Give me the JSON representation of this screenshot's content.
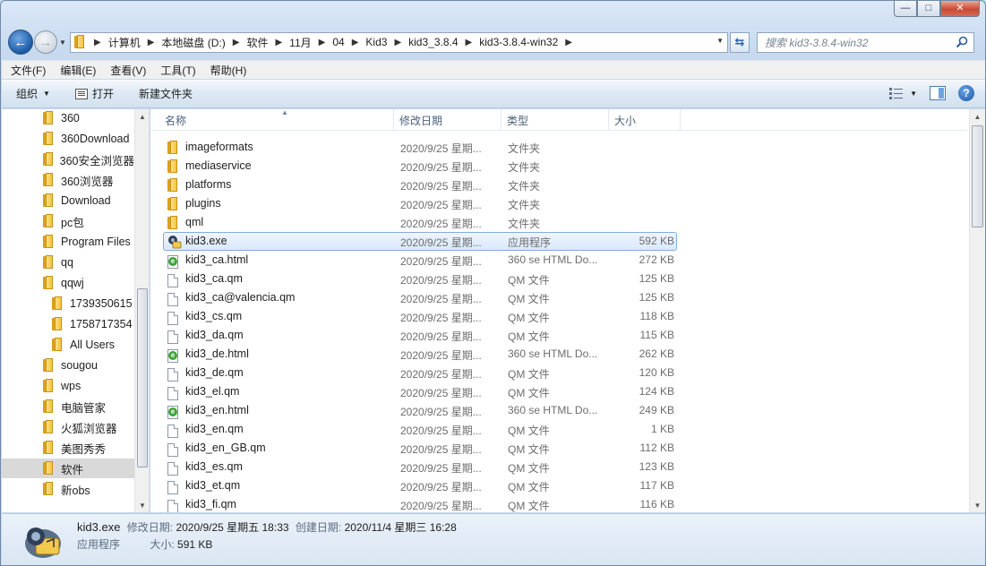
{
  "window": {
    "caption_buttons": {
      "minimize": "—",
      "maximize": "□",
      "close": "✕"
    }
  },
  "address_bar": {
    "breadcrumbs": [
      "计算机",
      "本地磁盘 (D:)",
      "软件",
      "11月",
      "04",
      "Kid3",
      "kid3_3.8.4",
      "kid3-3.8.4-win32"
    ]
  },
  "search": {
    "placeholder": "搜索 kid3-3.8.4-win32"
  },
  "menubar": {
    "items": [
      "文件(F)",
      "编辑(E)",
      "查看(V)",
      "工具(T)",
      "帮助(H)"
    ]
  },
  "commandbar": {
    "organize": "组织",
    "open": "打开",
    "new_folder": "新建文件夹"
  },
  "navpane": {
    "items": [
      {
        "label": "360",
        "indent": 0
      },
      {
        "label": "360Download",
        "indent": 0
      },
      {
        "label": "360安全浏览器",
        "indent": 0
      },
      {
        "label": "360浏览器",
        "indent": 0
      },
      {
        "label": "Download",
        "indent": 0
      },
      {
        "label": "pc包",
        "indent": 0
      },
      {
        "label": "Program Files",
        "indent": 0
      },
      {
        "label": "qq",
        "indent": 0
      },
      {
        "label": "qqwj",
        "indent": 0
      },
      {
        "label": "1739350615",
        "indent": 1
      },
      {
        "label": "1758717354",
        "indent": 1
      },
      {
        "label": "All Users",
        "indent": 1
      },
      {
        "label": "sougou",
        "indent": 0
      },
      {
        "label": "wps",
        "indent": 0
      },
      {
        "label": "电脑管家",
        "indent": 0
      },
      {
        "label": "火狐浏览器",
        "indent": 0
      },
      {
        "label": "美图秀秀",
        "indent": 0
      },
      {
        "label": "软件",
        "indent": 0,
        "selected": true
      },
      {
        "label": "新obs",
        "indent": 0
      }
    ]
  },
  "columns": {
    "name": "名称",
    "date": "修改日期",
    "type": "类型",
    "size": "大小"
  },
  "files": [
    {
      "name": "imageformats",
      "date": "2020/9/25 星期...",
      "type": "文件夹",
      "size": "",
      "icon": "folder-icon"
    },
    {
      "name": "mediaservice",
      "date": "2020/9/25 星期...",
      "type": "文件夹",
      "size": "",
      "icon": "folder-icon"
    },
    {
      "name": "platforms",
      "date": "2020/9/25 星期...",
      "type": "文件夹",
      "size": "",
      "icon": "folder-icon"
    },
    {
      "name": "plugins",
      "date": "2020/9/25 星期...",
      "type": "文件夹",
      "size": "",
      "icon": "folder-icon"
    },
    {
      "name": "qml",
      "date": "2020/9/25 星期...",
      "type": "文件夹",
      "size": "",
      "icon": "folder-icon"
    },
    {
      "name": "kid3.exe",
      "date": "2020/9/25 星期...",
      "type": "应用程序",
      "size": "592 KB",
      "icon": "exe-icon",
      "selected": true
    },
    {
      "name": "kid3_ca.html",
      "date": "2020/9/25 星期...",
      "type": "360 se HTML Do...",
      "size": "272 KB",
      "icon": "html-file-icon"
    },
    {
      "name": "kid3_ca.qm",
      "date": "2020/9/25 星期...",
      "type": "QM 文件",
      "size": "125 KB",
      "icon": "file-icon"
    },
    {
      "name": "kid3_ca@valencia.qm",
      "date": "2020/9/25 星期...",
      "type": "QM 文件",
      "size": "125 KB",
      "icon": "file-icon"
    },
    {
      "name": "kid3_cs.qm",
      "date": "2020/9/25 星期...",
      "type": "QM 文件",
      "size": "118 KB",
      "icon": "file-icon"
    },
    {
      "name": "kid3_da.qm",
      "date": "2020/9/25 星期...",
      "type": "QM 文件",
      "size": "115 KB",
      "icon": "file-icon"
    },
    {
      "name": "kid3_de.html",
      "date": "2020/9/25 星期...",
      "type": "360 se HTML Do...",
      "size": "262 KB",
      "icon": "html-file-icon"
    },
    {
      "name": "kid3_de.qm",
      "date": "2020/9/25 星期...",
      "type": "QM 文件",
      "size": "120 KB",
      "icon": "file-icon"
    },
    {
      "name": "kid3_el.qm",
      "date": "2020/9/25 星期...",
      "type": "QM 文件",
      "size": "124 KB",
      "icon": "file-icon"
    },
    {
      "name": "kid3_en.html",
      "date": "2020/9/25 星期...",
      "type": "360 se HTML Do...",
      "size": "249 KB",
      "icon": "html-file-icon"
    },
    {
      "name": "kid3_en.qm",
      "date": "2020/9/25 星期...",
      "type": "QM 文件",
      "size": "1 KB",
      "icon": "file-icon"
    },
    {
      "name": "kid3_en_GB.qm",
      "date": "2020/9/25 星期...",
      "type": "QM 文件",
      "size": "112 KB",
      "icon": "file-icon"
    },
    {
      "name": "kid3_es.qm",
      "date": "2020/9/25 星期...",
      "type": "QM 文件",
      "size": "123 KB",
      "icon": "file-icon"
    },
    {
      "name": "kid3_et.qm",
      "date": "2020/9/25 星期...",
      "type": "QM 文件",
      "size": "117 KB",
      "icon": "file-icon"
    },
    {
      "name": "kid3_fi.qm",
      "date": "2020/9/25 星期...",
      "type": "QM 文件",
      "size": "116 KB",
      "icon": "file-icon"
    }
  ],
  "details": {
    "name": "kid3.exe",
    "modified_label": "修改日期:",
    "modified_value": "2020/9/25 星期五 18:33",
    "created_label": "创建日期:",
    "created_value": "2020/11/4 星期三 16:28",
    "type": "应用程序",
    "size_label": "大小:",
    "size_value": "591 KB"
  },
  "colors": {
    "selection_border": "#84acdd",
    "selection_fill": "#d9e9fb",
    "nav_selected": "#d9d9d9"
  }
}
